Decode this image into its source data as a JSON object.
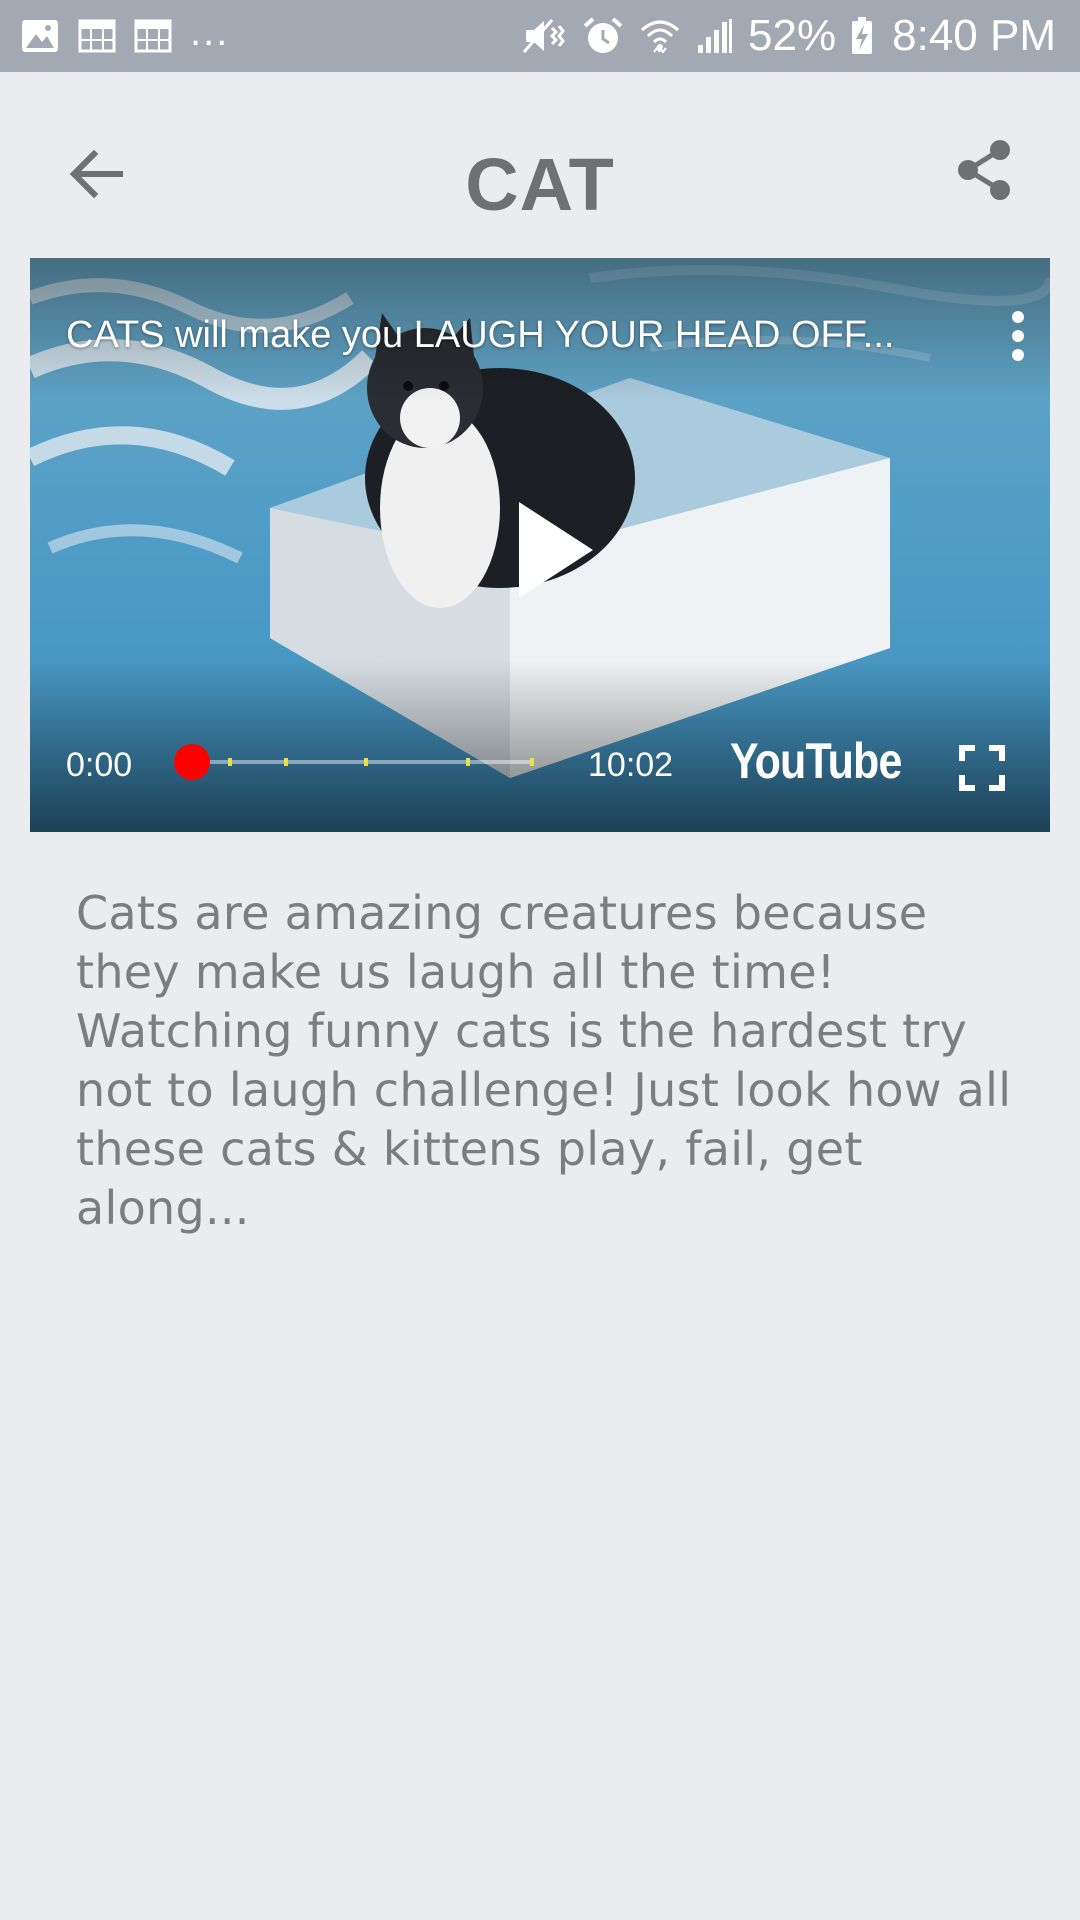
{
  "status_bar": {
    "left_icons": [
      "image-icon",
      "calendar-grid-icon",
      "calendar-grid-icon"
    ],
    "overflow": "...",
    "right_icons": [
      "mute-vibrate-icon",
      "alarm-icon",
      "wifi-icon",
      "cell-signal-icon"
    ],
    "battery_percent": "52%",
    "battery_icon": "battery-charging-icon",
    "time": "8:40 PM"
  },
  "app_bar": {
    "back_icon": "arrow-back-icon",
    "title": "CAT",
    "share_icon": "share-icon"
  },
  "video_player": {
    "title": "CATS will make you LAUGH YOUR HEAD OFF...",
    "current_time": "0:00",
    "duration": "10:02",
    "progress_fraction": 0,
    "logo_text": "YouTube",
    "colors": {
      "progress": "#ff0000",
      "marker": "#e8e04a"
    }
  },
  "description": "Cats are amazing creatures because they make us laugh all the time! Watching funny cats is the hardest try not to laugh challenge! Just look how all these cats & kittens play, fail, get along..."
}
